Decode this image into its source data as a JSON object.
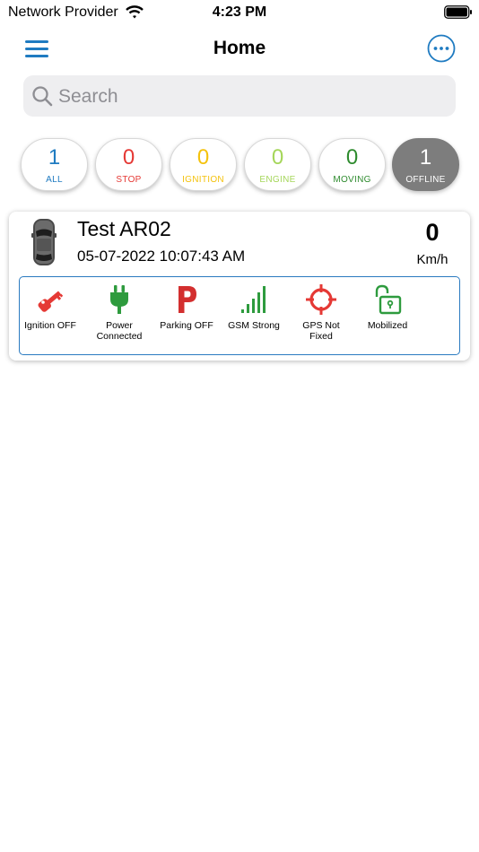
{
  "status_bar": {
    "carrier": "Network Provider",
    "time": "4:23 PM"
  },
  "nav": {
    "title": "Home",
    "menu_icon": "hamburger-menu-icon",
    "more_icon": "more-options-icon"
  },
  "search": {
    "placeholder": "Search"
  },
  "filters": [
    {
      "count": "1",
      "label": "ALL",
      "color": "#1f7bc1"
    },
    {
      "count": "0",
      "label": "STOP",
      "color": "#e53935"
    },
    {
      "count": "0",
      "label": "IGNITION",
      "color": "#f4c20d"
    },
    {
      "count": "0",
      "label": "ENGINE",
      "color": "#a5d65a"
    },
    {
      "count": "0",
      "label": "MOVING",
      "color": "#2e8b2e"
    },
    {
      "count": "1",
      "label": "OFFLINE",
      "color": "#ffffff",
      "background": "#7d7d7d"
    }
  ],
  "vehicles": [
    {
      "name": "Test AR02",
      "timestamp": "05-07-2022 10:07:43 AM",
      "speed": "0",
      "speed_unit": "Km/h",
      "indicators": [
        {
          "label": "Ignition OFF",
          "icon": "key-icon",
          "color": "#e53935"
        },
        {
          "label": "Power Connected",
          "icon": "plug-icon",
          "color": "#2e9b3e"
        },
        {
          "label": "Parking OFF",
          "icon": "parking-icon",
          "color": "#d32f2f"
        },
        {
          "label": "GSM Strong",
          "icon": "signal-icon",
          "color": "#2e9b3e"
        },
        {
          "label": "GPS Not Fixed",
          "icon": "gps-crosshair-icon",
          "color": "#e53935"
        },
        {
          "label": "Mobilized",
          "icon": "unlocked-padlock-icon",
          "color": "#2e9b3e"
        }
      ]
    }
  ],
  "colors": {
    "accent": "#1f7bc1",
    "panel_border": "#2a7ac0"
  }
}
